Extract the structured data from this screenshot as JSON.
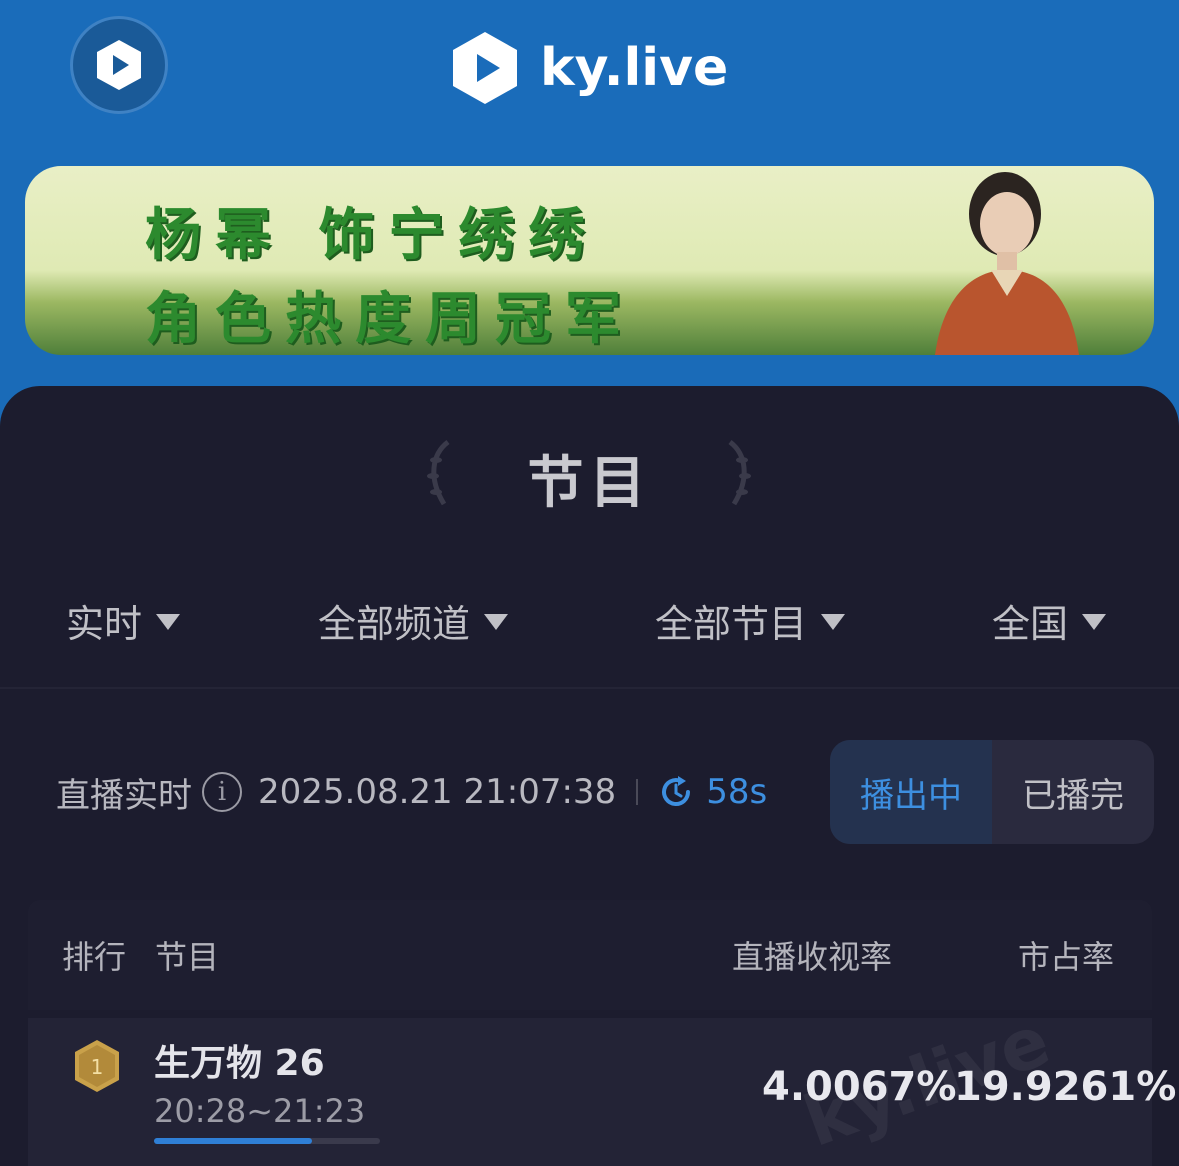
{
  "header": {
    "brand": "ky.live",
    "colors": {
      "header_bg": "#1a6cba",
      "accent": "#3d8fe0",
      "panel_bg": "#1c1c2e"
    }
  },
  "banner": {
    "line1": "杨幂 饰宁绣绣",
    "line2": "角色热度周冠军"
  },
  "panel": {
    "title": "节目"
  },
  "filters": [
    {
      "label": "实时"
    },
    {
      "label": "全部频道"
    },
    {
      "label": "全部节目"
    },
    {
      "label": "全国"
    }
  ],
  "status": {
    "label": "直播实时",
    "timestamp": "2025.08.21 21:07:38",
    "countdown": "58s"
  },
  "toggle": {
    "active": "播出中",
    "inactive": "已播完"
  },
  "table": {
    "headers": {
      "rank": "排行",
      "program": "节目",
      "rating": "直播收视率",
      "share": "市占率"
    },
    "rows": [
      {
        "rank": "1",
        "program": "生万物 26",
        "time": "20:28~21:23",
        "rating": "4.0067%",
        "share": "19.9261%",
        "progress": 0.7
      }
    ]
  },
  "icons": [
    "kylive-logo-icon",
    "caret-down-icon",
    "info-icon",
    "refresh-icon",
    "gold-medal-icon",
    "laurel-icon"
  ]
}
